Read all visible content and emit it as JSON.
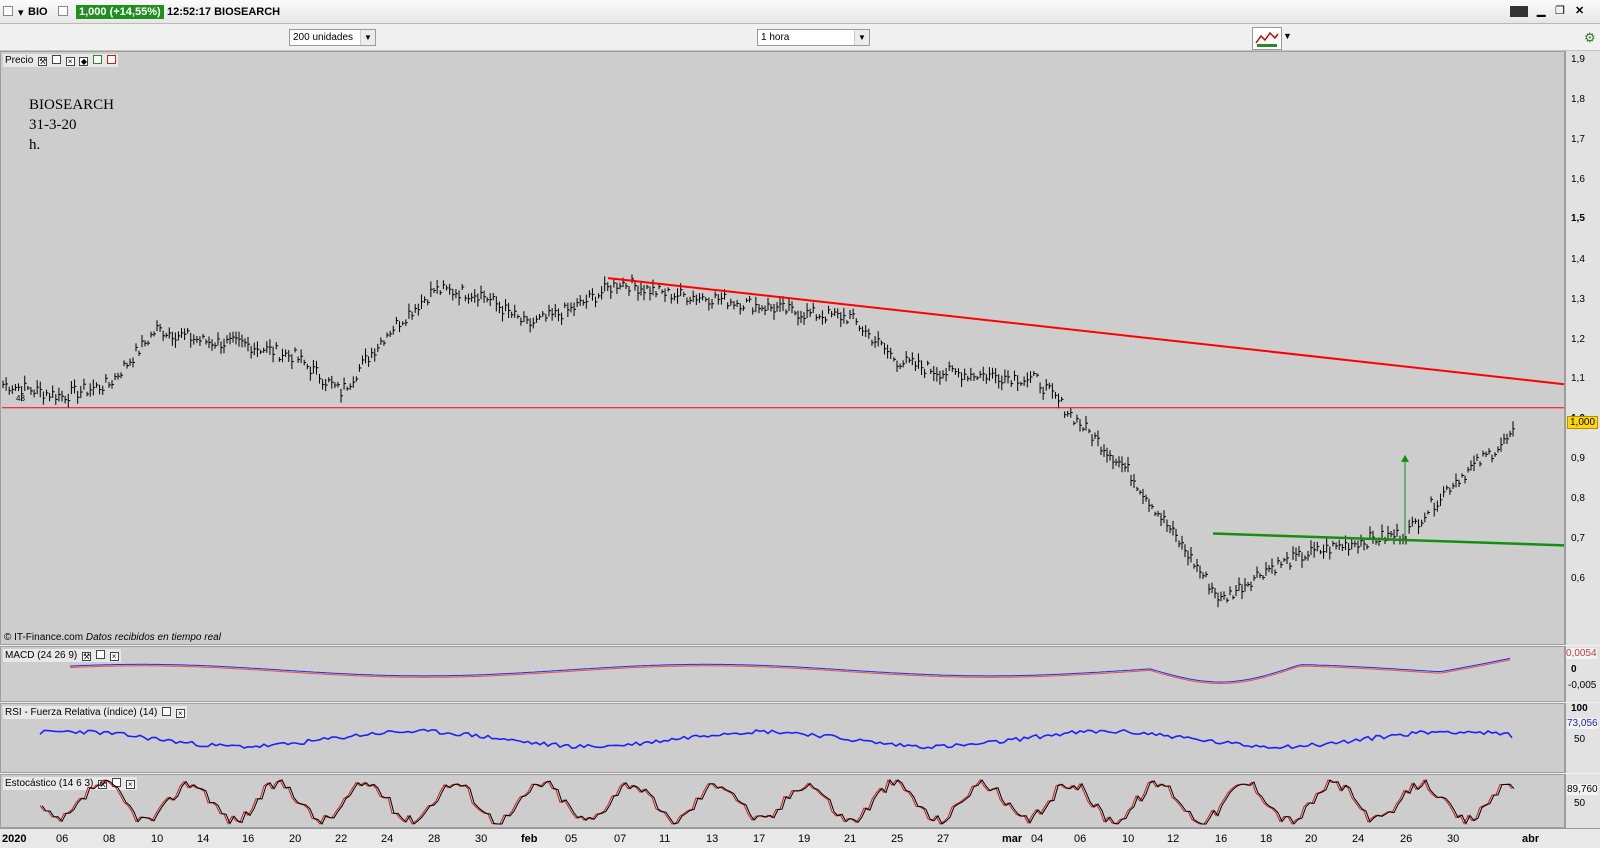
{
  "window": {
    "symbol": "BIO",
    "price_badge": "1,000 (+14,55%)",
    "time_name": "12:52:17 BIOSEARCH"
  },
  "toolbar": {
    "units": "200 unidades",
    "interval": "1 hora"
  },
  "price_panel": {
    "label": "Precio",
    "annotation": [
      "BIOSEARCH",
      "31-3-20",
      "h."
    ],
    "credit_source": "© IT-Finance.com",
    "credit_note": "Datos recibidos en tiempo real",
    "current_value": "1,000",
    "left_marker": "48",
    "axis_ticks": [
      "1,9",
      "1,8",
      "1,7",
      "1,6",
      "1,5",
      "1,4",
      "1,3",
      "1,2",
      "1,1",
      "1,0",
      "0,9",
      "0,8",
      "0,7",
      "0,6"
    ]
  },
  "macd_panel": {
    "label": "MACD (24 26 9)",
    "value": "0,0054",
    "axis_ticks": [
      "0",
      "-0,005"
    ]
  },
  "rsi_panel": {
    "label": "RSI - Fuerza Relativa (índice) (14)",
    "value": "73,056",
    "axis_ticks": [
      "100",
      "50"
    ]
  },
  "stoch_panel": {
    "label": "Estocástico (14 6 3)",
    "value": "89,760",
    "axis_ticks": [
      "50"
    ]
  },
  "x_labels": [
    "2020",
    "06",
    "08",
    "10",
    "14",
    "16",
    "20",
    "22",
    "24",
    "28",
    "30",
    "feb",
    "05",
    "07",
    "11",
    "13",
    "17",
    "19",
    "21",
    "25",
    "27",
    "mar",
    "04",
    "06",
    "10",
    "12",
    "16",
    "18",
    "20",
    "24",
    "26",
    "30",
    "abr"
  ],
  "colors": {
    "resistance_line": "#ff0000",
    "support_line": "#119011",
    "horizontal_line": "#ff0000",
    "rsi_line": "#1f1fff",
    "macd_line": "#2a2ad8",
    "macd_signal": "#e05050",
    "stoch_k": "#000000",
    "stoch_d": "#cc2020"
  },
  "chart_data": {
    "type": "line",
    "title": "BIOSEARCH",
    "ylim": [
      0.5,
      1.93
    ],
    "x": [
      "2020",
      "06",
      "08",
      "10",
      "14",
      "16",
      "20",
      "22",
      "24",
      "28",
      "30",
      "feb",
      "05",
      "07",
      "11",
      "13",
      "17",
      "19",
      "21",
      "25",
      "27",
      "mar",
      "04",
      "06",
      "10",
      "12",
      "16",
      "18",
      "20",
      "24",
      "26",
      "30",
      "abr"
    ],
    "series": [
      {
        "values": [
          1.1,
          1.07,
          1.1,
          1.24,
          1.21,
          1.2,
          1.17,
          1.08,
          1.23,
          1.34,
          1.33,
          1.25,
          1.29,
          1.36,
          1.33,
          1.32,
          1.3,
          1.28,
          1.27,
          1.16,
          1.13,
          1.12,
          1.11,
          1.0,
          0.88,
          0.72,
          0.55,
          0.63,
          0.67,
          0.7,
          0.72,
          0.85,
          1.0
        ]
      }
    ],
    "resistance_line": {
      "from": [
        "06 feb",
        1.37
      ],
      "to": [
        "abr",
        1.1
      ]
    },
    "support_line": {
      "from": [
        "13 mar",
        0.72
      ],
      "to": [
        "abr",
        0.69
      ]
    },
    "horizontal_line": 1.04,
    "target_arrow": {
      "from": 0.7,
      "to": 0.92
    }
  }
}
